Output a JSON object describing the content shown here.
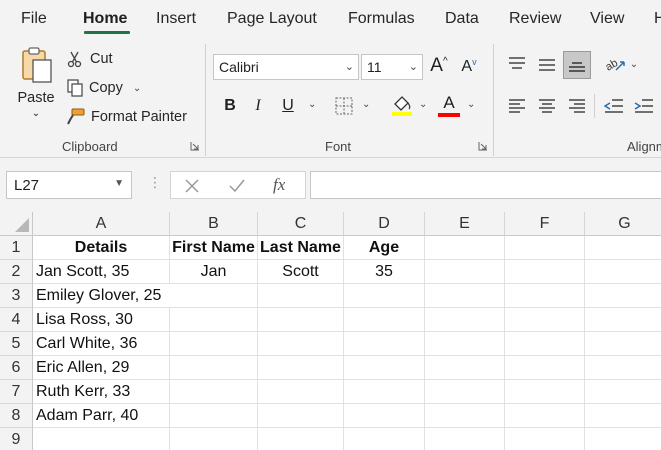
{
  "menu": {
    "tabs": [
      "File",
      "Home",
      "Insert",
      "Page Layout",
      "Formulas",
      "Data",
      "Review",
      "View",
      "H"
    ]
  },
  "clipboard": {
    "paste_label": "Paste",
    "cut_label": "Cut",
    "copy_label": "Copy",
    "format_painter_label": "Format Painter",
    "group_label": "Clipboard"
  },
  "font": {
    "font_name": "Calibri",
    "font_size": "11",
    "group_label": "Font",
    "bold_label": "B",
    "italic_label": "I",
    "underline_label": "U",
    "grow_label": "A",
    "shrink_label": "A",
    "font_color_label": "A",
    "highlight_color": "#ffff00",
    "font_color": "#ff0000"
  },
  "alignment": {
    "group_label": "Alignm"
  },
  "formula_bar": {
    "name_box": "L27",
    "fx_label": "fx",
    "formula": ""
  },
  "sheet": {
    "columns": [
      "A",
      "B",
      "C",
      "D",
      "E",
      "F",
      "G"
    ],
    "rows": [
      "1",
      "2",
      "3",
      "4",
      "5",
      "6",
      "7",
      "8",
      "9"
    ],
    "cells": {
      "A1": "Details",
      "B1": "First Name",
      "C1": "Last Name",
      "D1": "Age",
      "A2": "Jan Scott, 35",
      "B2": "Jan",
      "C2": "Scott",
      "D2": "35",
      "A3": "Emiley Glover, 25",
      "A4": "Lisa Ross, 30",
      "A5": "Carl White, 36",
      "A6": "Eric Allen, 29",
      "A7": "Ruth Kerr, 33",
      "A8": "Adam Parr, 40"
    }
  },
  "colors": {
    "accent": "#217346",
    "ribbon_bg": "#f3f3f3"
  }
}
